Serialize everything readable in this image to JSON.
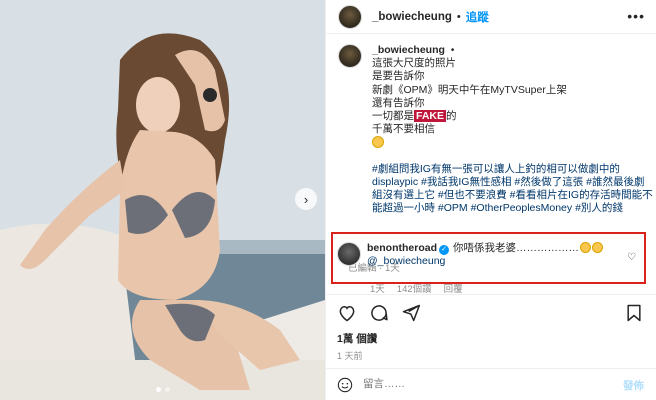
{
  "header": {
    "username": "_bowiecheung",
    "separator": "•",
    "follow_label": "追蹤",
    "more_label": "•••"
  },
  "caption": {
    "username": "_bowiecheung",
    "dot": "•",
    "lines": [
      "這張大尺度的照片",
      "是要告訴你",
      "新劇《OPM》明天中午在MyTVSuper上架",
      "還有告訴你"
    ],
    "line_fake_prefix": "一切都是",
    "line_fake_word": "FAKE",
    "line_fake_suffix": "的",
    "line_last": "千萬不要相信",
    "hashtags": "#劇組問我IG有無一張可以讓人上釣的相可以做劇中的displaypic #我話我IG無性感相 #然後做了這張 #誰然最後劇組沒有選上它 #但也不要浪費 #看看相片在IG的存活時間能不能超過一小時 #OPM #OtherPeoplesMoney #別人的錢",
    "edited": "已編輯 · 1天"
  },
  "comment": {
    "username": "benontheroad",
    "text": "你唔係我老婆………………",
    "mention": "@_bowiecheung",
    "time": "1天",
    "likes": "142個讚",
    "reply": "回覆"
  },
  "likes_count": "1萬 個讚",
  "posted_time": "1 天前",
  "add_comment": {
    "placeholder": "留言……",
    "post_label": "發佈"
  }
}
